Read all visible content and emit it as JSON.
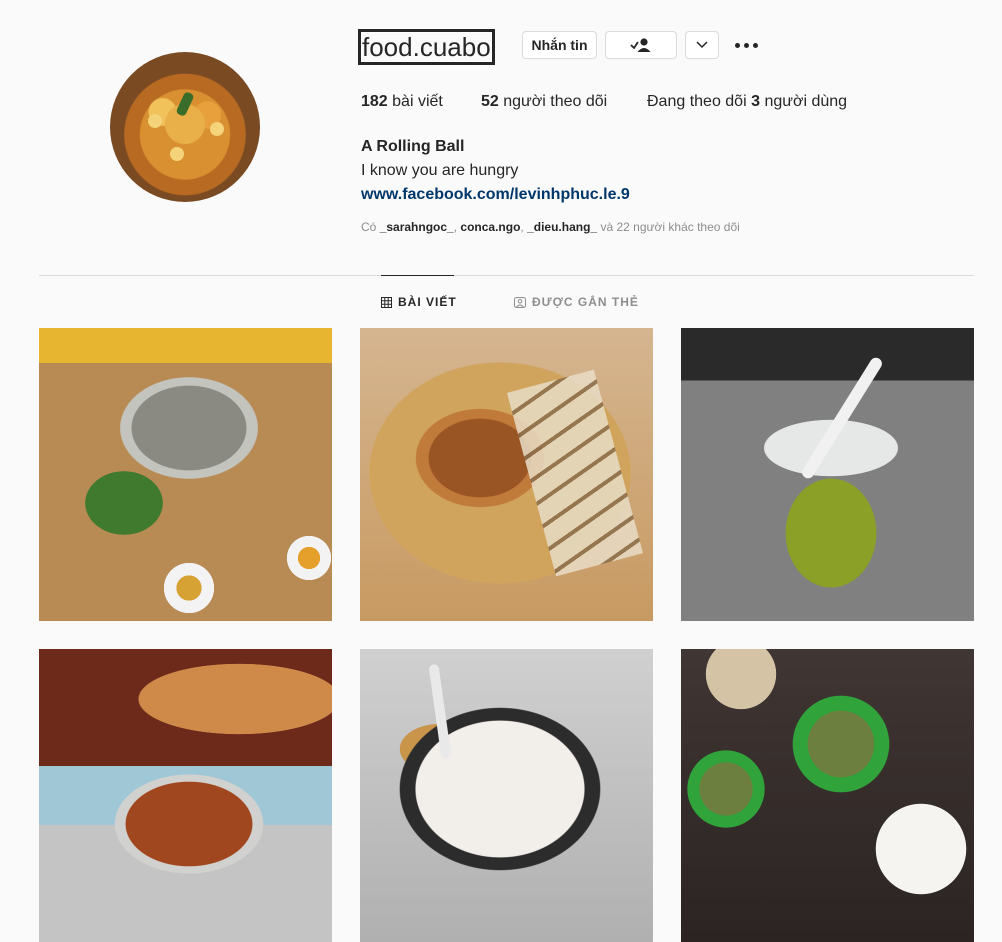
{
  "profile": {
    "username": "food.cuabo",
    "message_button": "Nhắn tin",
    "following_icon": "user-check-icon",
    "dropdown_icon": "chevron-down-icon",
    "more_icon": "more-horizontal-icon",
    "posts_count": "182",
    "posts_label": "bài viết",
    "followers_count": "52",
    "followers_label": "người theo dõi",
    "following_prefix": "Đang theo dõi",
    "following_count": "3",
    "following_suffix": "người dùng",
    "full_name": "A Rolling Ball",
    "bio": "I know you are hungry",
    "website": "www.facebook.com/levinhphuc.le.9",
    "followed_by": {
      "prefix": "Có",
      "names": [
        "_sarahngoc_",
        "conca.ngo",
        "_dieu.hang_"
      ],
      "suffix": "và 22 người khác theo dõi"
    }
  },
  "tabs": [
    {
      "label": "BÀI VIẾT",
      "icon": "grid-icon",
      "active": true
    },
    {
      "label": "ĐƯỢC GẮN THẺ",
      "icon": "tagged-icon",
      "active": false
    }
  ],
  "colors": {
    "link": "#00376b",
    "muted": "#8e8e8e",
    "text": "#262626"
  }
}
